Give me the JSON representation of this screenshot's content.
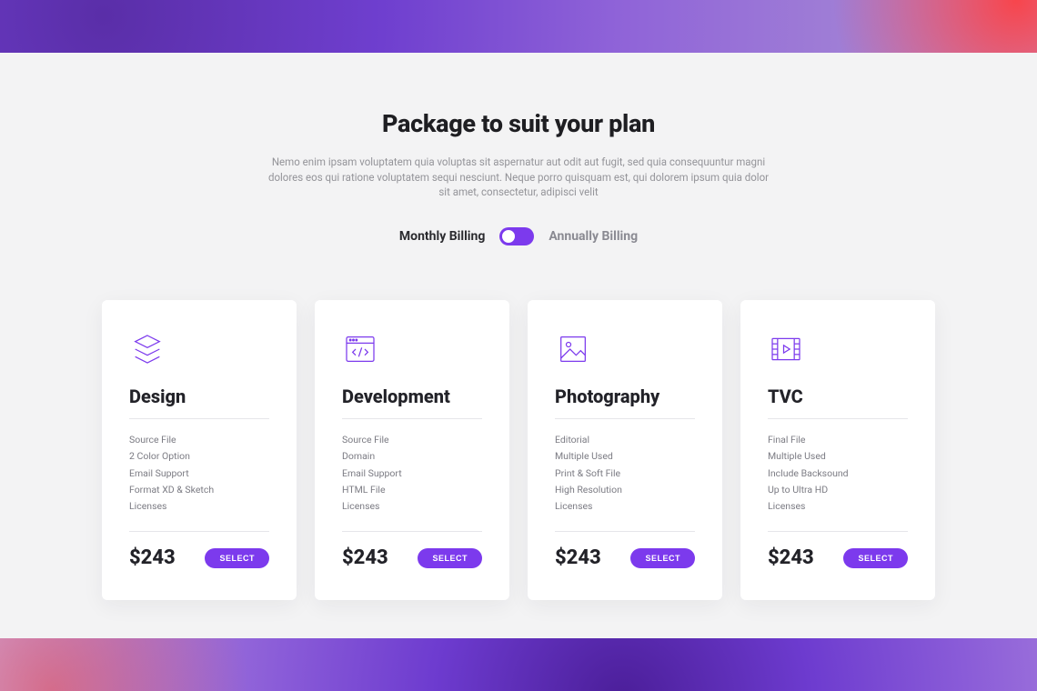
{
  "heading": "Package to suit your plan",
  "subtext": "Nemo enim ipsam voluptatem quia voluptas sit aspernatur aut odit aut fugit, sed quia consequuntur magni dolores eos qui ratione voluptatem sequi nesciunt. Neque porro quisquam est, qui dolorem ipsum quia dolor sit amet, consectetur, adipisci velit",
  "billing": {
    "monthly": "Monthly Billing",
    "annually": "Annually Billing"
  },
  "cards": [
    {
      "title": "Design",
      "features": [
        "Source File",
        "2 Color Option",
        "Email Support",
        "Format XD & Sketch",
        "Licenses"
      ],
      "price": "$243",
      "button": "SELECT"
    },
    {
      "title": "Development",
      "features": [
        "Source File",
        "Domain",
        "Email Support",
        "HTML File",
        "Licenses"
      ],
      "price": "$243",
      "button": "SELECT"
    },
    {
      "title": "Photography",
      "features": [
        "Editorial",
        "Multiple Used",
        "Print & Soft File",
        "High Resolution",
        "Licenses"
      ],
      "price": "$243",
      "button": "SELECT"
    },
    {
      "title": "TVC",
      "features": [
        "Final File",
        "Multiple Used",
        "Include Backsound",
        "Up to Ultra HD",
        "Licenses"
      ],
      "price": "$243",
      "button": "SELECT"
    }
  ]
}
